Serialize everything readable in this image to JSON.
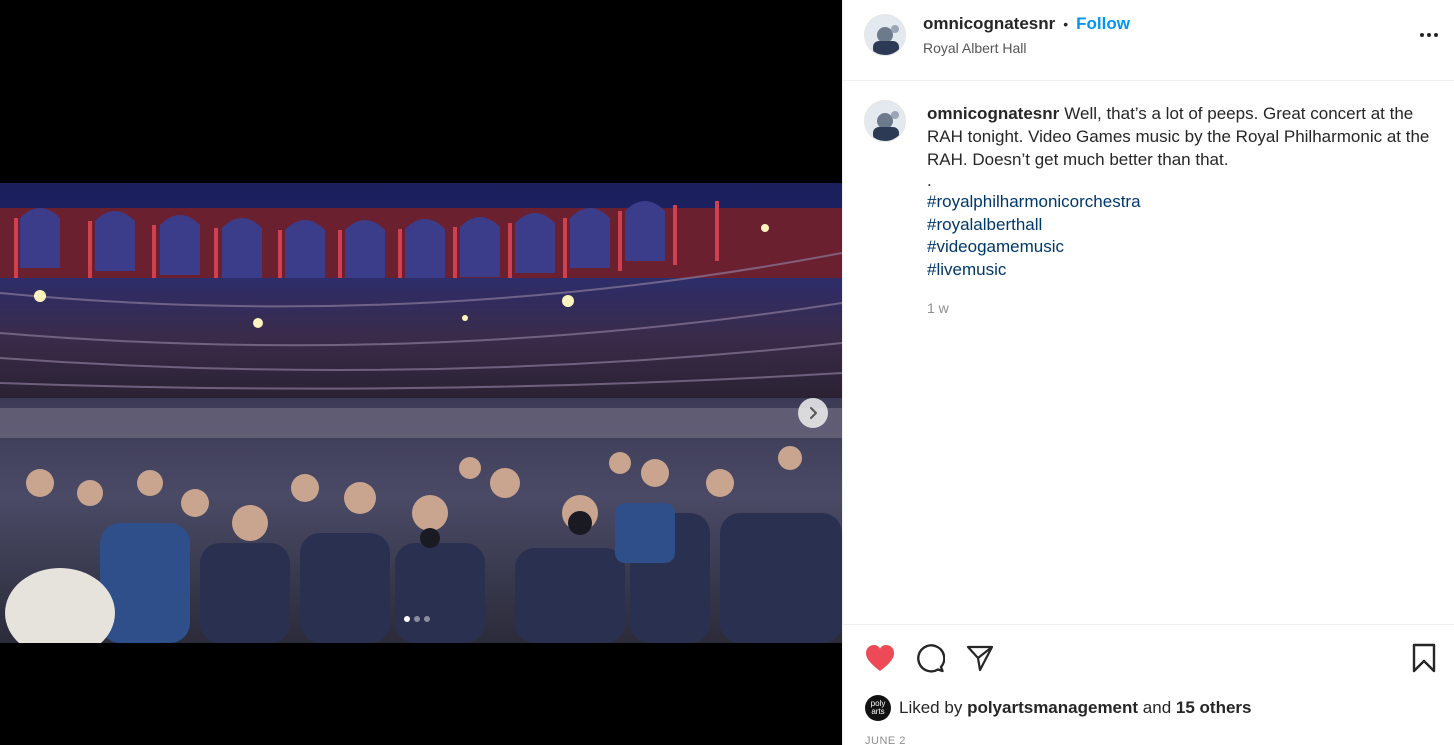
{
  "post": {
    "username": "omnicognatesnr",
    "separator": "•",
    "follow_label": "Follow",
    "location": "Royal Albert Hall",
    "more_icon": "more-horizontal-icon"
  },
  "media": {
    "image_alt": "Crowd inside the Royal Albert Hall concert auditorium",
    "carousel_count": 3,
    "carousel_active": 0,
    "next_icon": "chevron-right-icon"
  },
  "caption": {
    "username": "omnicognatesnr",
    "text": "Well, that’s a lot of peeps. Great concert at the RAH tonight. Video Games music by the Royal Philharmonic at the RAH. Doesn’t get much better than that.",
    "dot": ".",
    "hashtags": [
      "#royalphilharmonicorchestra",
      "#royalalberthall",
      "#videogamemusic",
      "#livemusic"
    ],
    "time": "1 w"
  },
  "actions": {
    "like_icon": "heart-filled-icon",
    "comment_icon": "comment-icon",
    "share_icon": "send-icon",
    "save_icon": "bookmark-icon",
    "like_color": "#ed4956"
  },
  "likes": {
    "avatar_text": "poly arts",
    "prefix": "Liked by",
    "user": "polyartsmanagement",
    "middle": "and",
    "others": "15 others"
  },
  "date": "JUNE 2"
}
